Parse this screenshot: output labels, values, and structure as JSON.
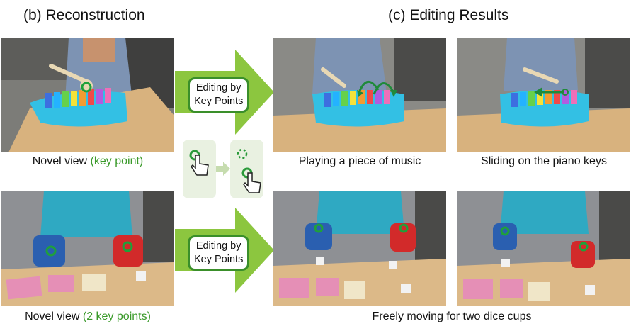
{
  "headings": {
    "reconstruction": "(b) Reconstruction",
    "editing": "(c) Editing Results"
  },
  "captions": {
    "row1_novel_prefix": "Novel view ",
    "row1_novel_highlight": "(key point)",
    "row2_novel_prefix": "Novel view ",
    "row2_novel_highlight": "(2 key points)",
    "playing": "Playing a piece of music",
    "sliding": "Sliding on the piano keys",
    "dice": "Freely moving for two dice cups"
  },
  "callouts": {
    "top": [
      "Editing by",
      "Key Points"
    ],
    "bottom": [
      "Editing by",
      "Key Points"
    ]
  },
  "colors": {
    "accent_green": "#3a9a2a",
    "arrow_green": "#8cc63f",
    "panel_green": "#e9f1e1",
    "cup_blue": "#2a5fb0",
    "cup_red": "#d22a2a",
    "xylophone_cyan": "#3cc6e8",
    "table_wood": "#d9b07a"
  },
  "icons": [
    "hand-pointer-icon",
    "dashed-circle-icon",
    "keypoint-marker-icon",
    "curved-arrow-icon",
    "left-arrow-icon"
  ]
}
